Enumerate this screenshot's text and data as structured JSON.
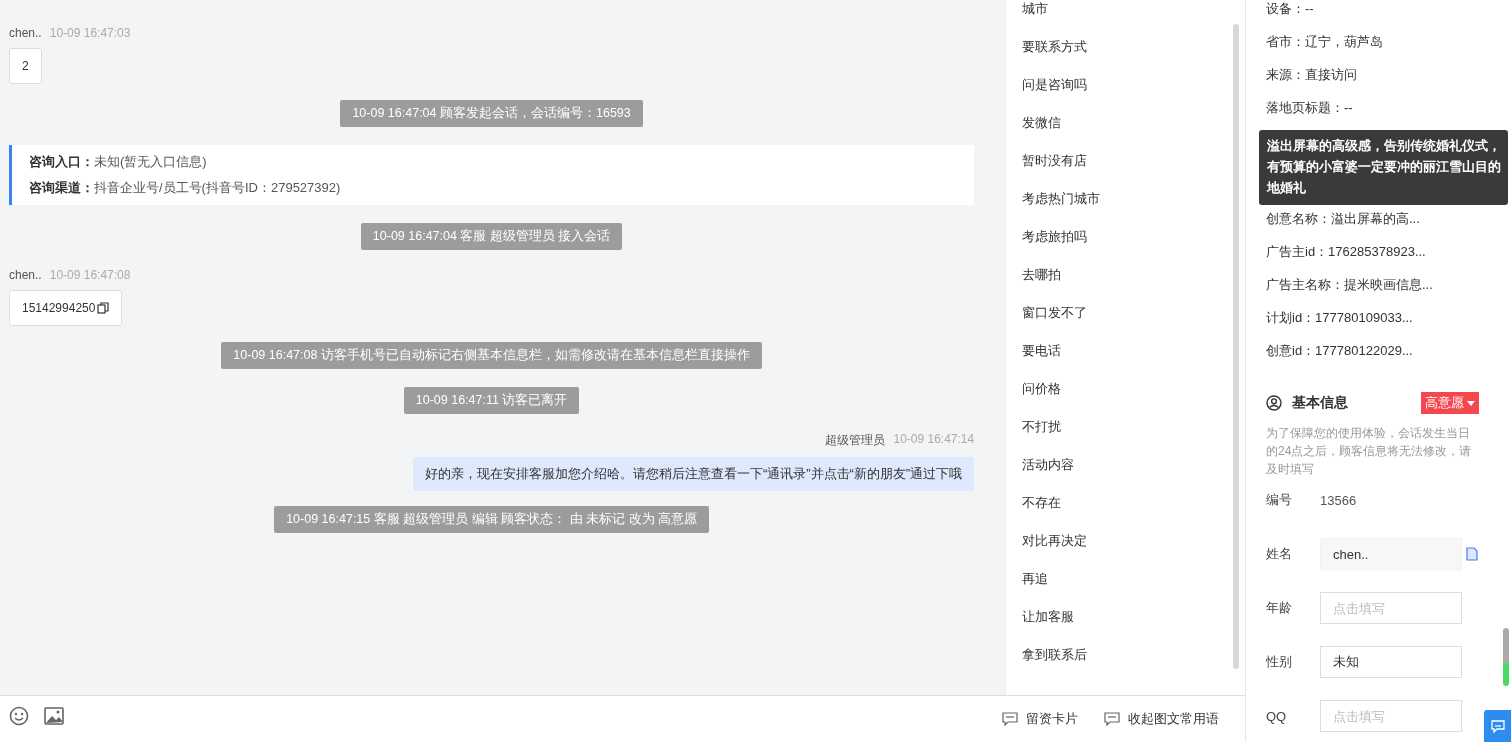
{
  "chat": {
    "messages": [
      {
        "kind": "visitor",
        "name": "chen..",
        "time": "10-09 16:47:03",
        "text": "2",
        "copyable": false
      },
      {
        "kind": "notice",
        "text": "10-09 16:47:04 顾客发起会话，会话编号：16593"
      },
      {
        "kind": "source",
        "lines": [
          {
            "label": "咨询入口：",
            "value": "未知(暂无入口信息)"
          },
          {
            "label": "咨询渠道：",
            "value": "抖音企业号/员工号(抖音号ID：279527392)"
          }
        ]
      },
      {
        "kind": "notice",
        "text": "10-09 16:47:04 客服 超级管理员 接入会话"
      },
      {
        "kind": "visitor",
        "name": "chen..",
        "time": "10-09 16:47:08",
        "text": "15142994250",
        "copyable": true
      },
      {
        "kind": "notice",
        "text": "10-09 16:47:08 访客手机号已自动标记右侧基本信息栏，如需修改请在基本信息栏直接操作"
      },
      {
        "kind": "notice",
        "text": "10-09 16:47:11 访客已离开"
      },
      {
        "kind": "agent",
        "name": "超级管理员",
        "time": "10-09 16:47:14",
        "text": "好的亲，现在安排客服加您介绍哈。请您稍后注意查看一下“通讯录”并点击“新的朋友”通过下哦"
      },
      {
        "kind": "notice",
        "text": "10-09 16:47:15 客服 超级管理员 编辑 顾客状态： 由 未标记 改为 高意愿"
      }
    ]
  },
  "quick_replies": [
    "城市",
    "要联系方式",
    "问是咨询吗",
    "发微信",
    "暂时没有店",
    "考虑热门城市",
    "考虑旅拍吗",
    "去哪拍",
    "窗口发不了",
    "要电话",
    "问价格",
    "不打扰",
    "活动内容",
    "不存在",
    "对比再决定",
    "再追",
    "让加客服",
    "拿到联系后"
  ],
  "toolbar": {
    "right_buttons": [
      "留资卡片",
      "收起图文常用语"
    ]
  },
  "info": {
    "rows": [
      "设备：--",
      "省市：辽宁，葫芦岛",
      "来源：直接访问",
      "落地页标题：--"
    ],
    "rows_below": [
      "创意名称：溢出屏幕的高...",
      "广告主id：176285378923...",
      "广告主名称：提米映画信息...",
      "计划id：177780109033...",
      "创意id：177780122029..."
    ],
    "tooltip": "溢出屏幕的高级感，告别传统婚礼仪式，有预算的小富婆一定要冲的丽江雪山目的地婚礼"
  },
  "basic": {
    "title": "基本信息",
    "status": "高意愿",
    "notice": "为了保障您的使用体验，会话发生当日的24点之后，顾客信息将无法修改，请及时填写",
    "fields": [
      {
        "kind": "text",
        "label": "编号",
        "value": "13566"
      },
      {
        "kind": "readonly",
        "label": "姓名",
        "value": "chen.."
      },
      {
        "kind": "input",
        "label": "年龄",
        "placeholder": "点击填写"
      },
      {
        "kind": "input",
        "label": "性别",
        "value": "未知"
      },
      {
        "kind": "input",
        "label": "QQ",
        "placeholder": "点击填写"
      }
    ]
  }
}
